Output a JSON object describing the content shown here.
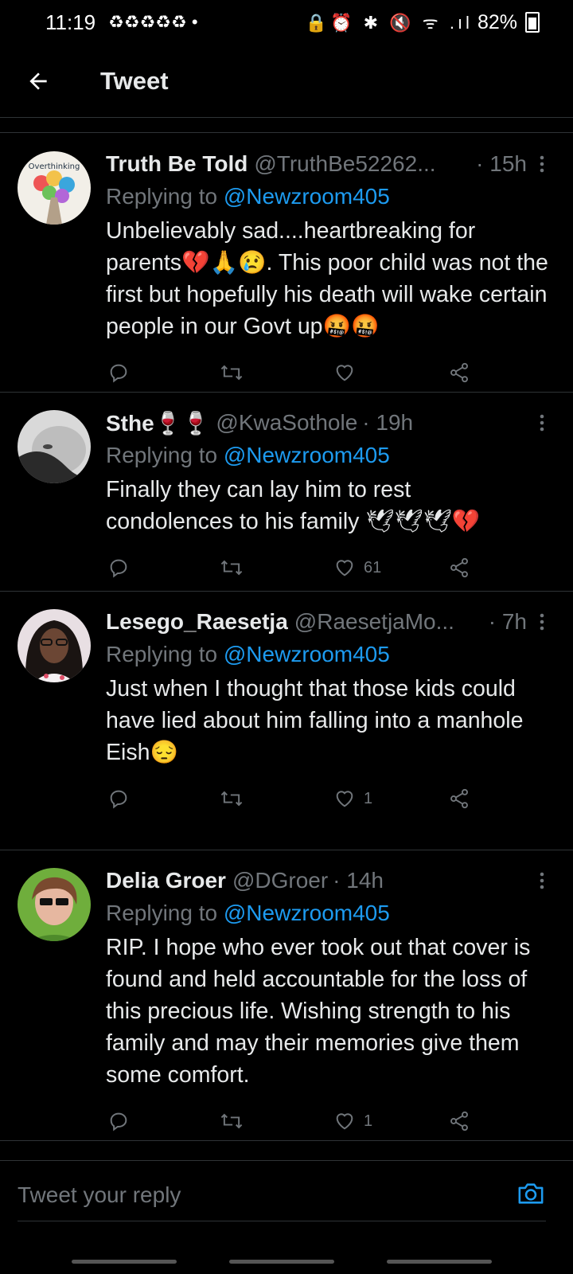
{
  "status_bar": {
    "time": "11:19",
    "notifications": "♻♻♻♻♻ •",
    "icons": "🔒⏰ ✱ 🔇 ᯤ .ıl",
    "battery": "82%"
  },
  "header": {
    "title": "Tweet"
  },
  "tweets": [
    {
      "name": "Truth Be Told",
      "handle": "@TruthBe52262...",
      "time": "· 15h",
      "replying_label": "Replying to",
      "replying_to": "@Newzroom405",
      "text": "Unbelievably sad....heartbreaking for parents💔🙏😢. This poor child was not the first but hopefully his death will wake certain people in our Govt up🤬🤬",
      "likes": ""
    },
    {
      "name": "Sthe🍷🍷",
      "handle": "@KwaSothole",
      "time": "· 19h",
      "replying_label": "Replying to",
      "replying_to": "@Newzroom405",
      "text": "Finally they can lay him to rest\ncondolences to his family 🕊🕊🕊💔",
      "likes": "61"
    },
    {
      "name": "Lesego_Raesetja",
      "handle": "@RaesetjaMo...",
      "time": "· 7h",
      "replying_label": "Replying to",
      "replying_to": "@Newzroom405",
      "text": "Just when I thought that those kids could have lied about him falling into a manhole\nEish😔",
      "likes": "1"
    },
    {
      "name": "Delia Groer",
      "handle": "@DGroer",
      "time": "· 14h",
      "replying_label": "Replying to",
      "replying_to": "@Newzroom405",
      "text": "RIP. I hope who ever took out that cover is found and held accountable for the loss of this precious life. Wishing strength to his family and may their memories give them some comfort.",
      "likes": "1"
    }
  ],
  "compose": {
    "placeholder": "Tweet your reply"
  },
  "icons": {
    "back": "arrow-left-icon",
    "reply": "reply-icon",
    "retweet": "retweet-icon",
    "like": "heart-icon",
    "share": "share-icon",
    "more": "more-vertical-icon",
    "camera": "camera-icon"
  },
  "colors": {
    "background": "#000000",
    "accent": "#1d9bf0",
    "muted": "#71767b",
    "text": "#e7e9ea"
  }
}
